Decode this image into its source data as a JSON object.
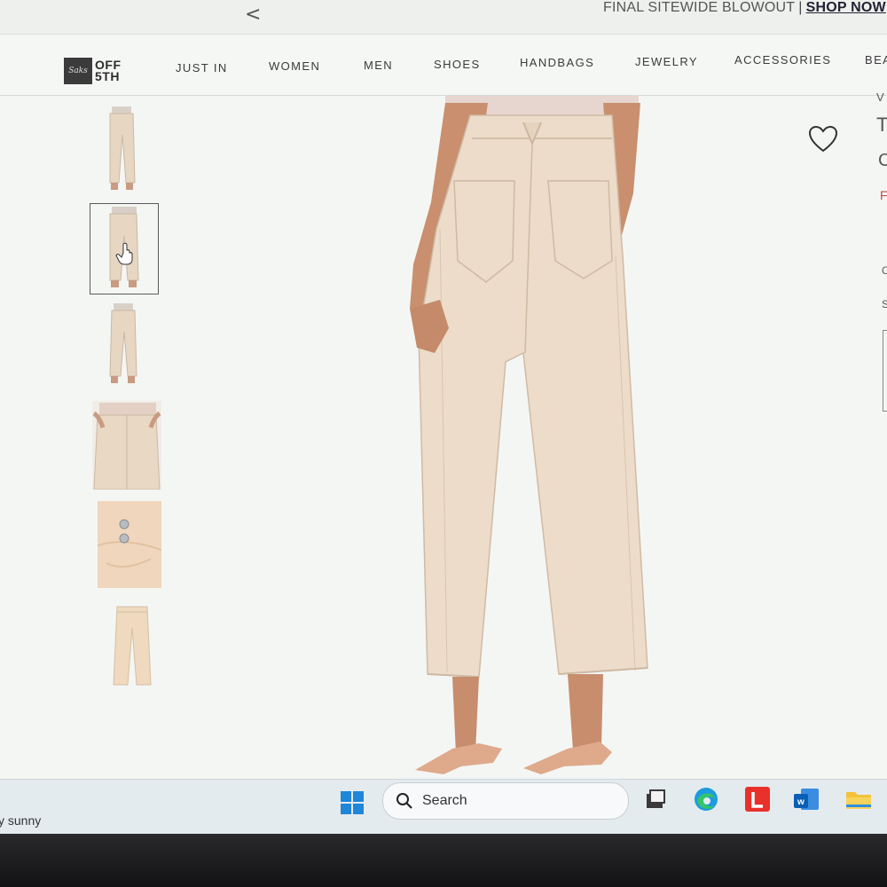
{
  "promo": {
    "back_glyph": "<",
    "message": "FINAL SITEWIDE BLOWOUT",
    "separator": "|",
    "link": "SHOP NOW"
  },
  "logo": {
    "badge": "Saks",
    "text_line1": "OFF",
    "text_line2": "5TH"
  },
  "nav": {
    "items": [
      "JUST IN",
      "WOMEN",
      "MEN",
      "SHOES",
      "HANDBAGS",
      "JEWELRY",
      "ACCESSORIES",
      "BEA"
    ]
  },
  "gallery": {
    "thumbnail_count": 6,
    "selected_index": 1,
    "views": [
      "front-full",
      "back-full",
      "side-full",
      "front-waist-closeup",
      "button-detail",
      "flat-product"
    ]
  },
  "product": {
    "color": "#e8d9c8",
    "edge_glyphs": [
      "V",
      "T",
      "C",
      "F",
      "C",
      "S"
    ]
  },
  "taskbar": {
    "weather": "y sunny",
    "search_label": "Search",
    "pinned_icons": [
      "task-view-icon",
      "edge-browser-icon",
      "l-app-icon",
      "outlook-icon",
      "file-explorer-icon"
    ]
  },
  "colors": {
    "accent_blue": "#0a78d4",
    "red_app": "#e8312b",
    "folder_yellow": "#f2c33a"
  }
}
